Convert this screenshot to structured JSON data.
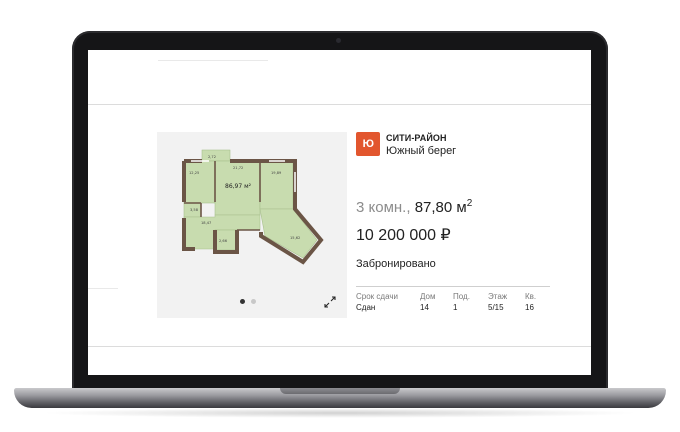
{
  "complex": {
    "developer": "СИТИ-РАЙОН",
    "name": "Южный берег",
    "logo_text": "Ю"
  },
  "apartment": {
    "rooms": "3 комн.,",
    "area": "87,80 м",
    "area_sup": "2",
    "price": "10 200 000 ₽",
    "status": "Забронировано"
  },
  "specs": [
    {
      "label": "Срок сдачи",
      "value": "Сдан"
    },
    {
      "label": "Дом",
      "value": "14"
    },
    {
      "label": "Под.",
      "value": "1"
    },
    {
      "label": "Этаж",
      "value": "5/15"
    },
    {
      "label": "Кв.",
      "value": "16"
    }
  ],
  "plan": {
    "total_area": "86,97 м²",
    "rooms": [
      {
        "name": "balcony-top",
        "area": "2,72"
      },
      {
        "name": "room-left",
        "area": "12,25"
      },
      {
        "name": "room-center",
        "area": "21,72"
      },
      {
        "name": "room-right",
        "area": "19,89"
      },
      {
        "name": "bath",
        "area": "3,58"
      },
      {
        "name": "hall",
        "area": "18,47"
      },
      {
        "name": "storage",
        "area": "2,66"
      },
      {
        "name": "room-bottom-right",
        "area": "15,62"
      }
    ],
    "colors": {
      "room": "#c8dcaf",
      "wall": "#6b5546",
      "room_line": "#a9c08e"
    }
  },
  "gallery": {
    "slides": 2,
    "active": 1
  }
}
